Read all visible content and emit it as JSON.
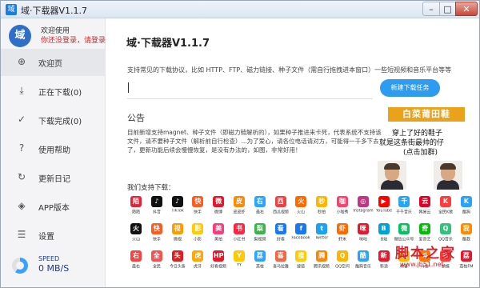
{
  "window": {
    "title": "域·下载器V1.1.7",
    "min": "–",
    "max": "□",
    "close": "✕",
    "icon_char": "域"
  },
  "user": {
    "avatar_char": "域",
    "welcome": "欢迎使用",
    "login": "你还没登录，请登录"
  },
  "sidebar": {
    "items": [
      {
        "label": "欢迎页",
        "icon": "plus-circle-icon",
        "glyph": "⊕"
      },
      {
        "label": "正在下载(0)",
        "icon": "download-icon",
        "glyph": "⤓"
      },
      {
        "label": "下载完成(0)",
        "icon": "check-circle-icon",
        "glyph": "✓"
      },
      {
        "label": "使用帮助",
        "icon": "help-icon",
        "glyph": "?"
      },
      {
        "label": "更新日记",
        "icon": "update-icon",
        "glyph": "↻"
      },
      {
        "label": "APP版本",
        "icon": "app-icon",
        "glyph": "◈"
      },
      {
        "label": "设置",
        "icon": "settings-icon",
        "glyph": "☰"
      }
    ],
    "speed_label": "SPEED",
    "speed_value": "0 MB/S"
  },
  "main": {
    "title": "域·下载器V1.1.7",
    "description": "支持常见的下载协议，比如 HTTP、FTP、磁力链接、种子文件（需自行拖拽进本窗口）一些短视频和音乐平台等等",
    "url_placeholder": "",
    "new_task_label": "新建下载任务",
    "notice_title": "公告",
    "notice_text": "目前新增支持magnet、种子文件（即磁力链解析的），如果种子推进来卡死，代表系统不支持该文件，请不要种子文件（解析前自行检查）...为了爱心，请各位电话请对方，可能得一千多下去了，更新功能后续会慢慢恢复，是没有办法的，如图，非常好用！",
    "support_title": "我们支持下载："
  },
  "ad": {
    "banner": "白菜莆田鞋",
    "line1": "穿上了好的鞋子",
    "line2": "就是这条街最帅的仔",
    "line3": "(点击加群)"
  },
  "platforms": [
    [
      {
        "name": "陌陌",
        "color": "#e2233a",
        "char": "陌"
      },
      {
        "name": "抖音",
        "color": "#111111",
        "char": "♪"
      },
      {
        "name": "TikTok",
        "color": "#111111",
        "char": "♪"
      },
      {
        "name": "快手",
        "color": "#ff5a1f",
        "char": "快"
      },
      {
        "name": "微博",
        "color": "#e6162d",
        "char": "微"
      },
      {
        "name": "皮皮虾",
        "color": "#ff8a00",
        "char": "皮"
      },
      {
        "name": "最右",
        "color": "#2ba5ff",
        "char": "右"
      },
      {
        "name": "西瓜视频",
        "color": "#f04142",
        "char": "西"
      },
      {
        "name": "火山",
        "color": "#ff6a00",
        "char": "火"
      },
      {
        "name": "秒拍",
        "color": "#ffb400",
        "char": "秒"
      },
      {
        "name": "小咖秀",
        "color": "#ff3e6c",
        "char": "咖"
      },
      {
        "name": "Instagram",
        "color": "#c13584",
        "char": "◎"
      },
      {
        "name": "YouTube",
        "color": "#ff0000",
        "char": "▶"
      },
      {
        "name": "千千音乐",
        "color": "#27a4f2",
        "char": "千"
      },
      {
        "name": "网易云",
        "color": "#e60026",
        "char": "云"
      },
      {
        "name": "全民K歌",
        "color": "#ff3c3c",
        "char": "K"
      },
      {
        "name": "酷狗",
        "color": "#2ca2f9",
        "char": "K"
      }
    ],
    [
      {
        "name": "火山",
        "color": "#111111",
        "char": "火"
      },
      {
        "name": "快手",
        "color": "#ff5a1f",
        "char": "快"
      },
      {
        "name": "微视",
        "color": "#ff9a00",
        "char": "视"
      },
      {
        "name": "小影",
        "color": "#ffcc00",
        "char": "影"
      },
      {
        "name": "美拍",
        "color": "#ff3a7c",
        "char": "美"
      },
      {
        "name": "小红书",
        "color": "#ff2442",
        "char": "书"
      },
      {
        "name": "梨视频",
        "color": "#39b54a",
        "char": "梨"
      },
      {
        "name": "好看",
        "color": "#1677ff",
        "char": "看"
      },
      {
        "name": "Facebook",
        "color": "#1877f2",
        "char": "f"
      },
      {
        "name": "Twitter",
        "color": "#1da1f2",
        "char": "t"
      },
      {
        "name": "虾米",
        "color": "#ff6a00",
        "char": "虾"
      },
      {
        "name": "咪咕",
        "color": "#e6162d",
        "char": "咪"
      },
      {
        "name": "B站",
        "color": "#00a1d6",
        "char": "B"
      },
      {
        "name": "微信公众号",
        "color": "#07c160",
        "char": "微"
      },
      {
        "name": "爱奇艺",
        "color": "#00be06",
        "char": "奇"
      },
      {
        "name": "QQ音乐",
        "color": "#31c27c",
        "char": "Q"
      },
      {
        "name": "酷我",
        "color": "#ff8a00",
        "char": "我"
      }
    ],
    [
      {
        "name": "最右",
        "color": "#ff3e3e",
        "char": "右"
      },
      {
        "name": "全民",
        "color": "#ff4d4f",
        "char": "全"
      },
      {
        "name": "今日头条",
        "color": "#e02020",
        "char": "头"
      },
      {
        "name": "虎牙",
        "color": "#ffa800",
        "char": "虎"
      },
      {
        "name": "好看视频",
        "color": "#e6162d",
        "char": "HP"
      },
      {
        "name": "YY",
        "color": "#ffc800",
        "char": "Y"
      },
      {
        "name": "荔枝",
        "color": "#2da5ff",
        "char": "荔"
      },
      {
        "name": "喜马拉雅",
        "color": "#f86442",
        "char": "喜"
      },
      {
        "name": "搜狐",
        "color": "#ffcc00",
        "char": "搜"
      },
      {
        "name": "腾讯视频",
        "color": "#ff8400",
        "char": "腾"
      },
      {
        "name": "QQ空间",
        "color": "#ffb400",
        "char": "Q"
      },
      {
        "name": "酷狗音乐",
        "color": "#2ca2f9",
        "char": "酷"
      },
      {
        "name": "新浪",
        "color": "#e6162d",
        "char": "新"
      },
      {
        "name": "映客",
        "color": "#ffb400",
        "char": "映"
      },
      {
        "name": "斗鱼",
        "color": "#ff7500",
        "char": "斗"
      },
      {
        "name": "蜻蜓",
        "color": "#ff3a3a",
        "char": "蜻"
      },
      {
        "name": "荔枝FM",
        "color": "#e6162d",
        "char": "荔"
      }
    ]
  ],
  "watermark": {
    "text": "脚本之家",
    "url": "www.jb51.net"
  }
}
